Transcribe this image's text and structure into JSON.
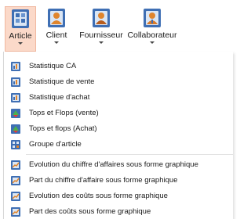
{
  "ribbon": {
    "buttons": [
      {
        "label": "Article",
        "icon": "article-icon",
        "active": true
      },
      {
        "label": "Client",
        "icon": "client-icon"
      },
      {
        "label": "Fournisseur",
        "icon": "supplier-icon"
      },
      {
        "label": "Collaborateur",
        "icon": "employee-icon"
      }
    ]
  },
  "menu": {
    "items": [
      {
        "label": "Statistique CA",
        "icon": "stats-icon"
      },
      {
        "label": "Statistique de vente",
        "icon": "stats-icon"
      },
      {
        "label": "Statistique d'achat",
        "icon": "stats-icon"
      },
      {
        "label": "Tops et Flops (vente)",
        "icon": "tops-flops-icon"
      },
      {
        "label": "Tops et flops (Achat)",
        "icon": "tops-flops-icon"
      },
      {
        "label": "Groupe d'article",
        "icon": "article-group-icon"
      },
      {
        "label": "Evolution du chiffre d'affaires sous forme graphique",
        "icon": "chart-icon"
      },
      {
        "label": "Part du chiffre d'affaire sous forme graphique",
        "icon": "chart-icon"
      },
      {
        "label": "Evolution des coûts sous forme graphique",
        "icon": "chart-icon"
      },
      {
        "label": "Part des coûts sous forme graphique",
        "icon": "chart-icon"
      }
    ]
  },
  "colors": {
    "active_bg": "#fbd9c9",
    "active_border": "#f0b8a0",
    "icon_blue": "#3f6fb4",
    "icon_orange": "#e0852c"
  }
}
